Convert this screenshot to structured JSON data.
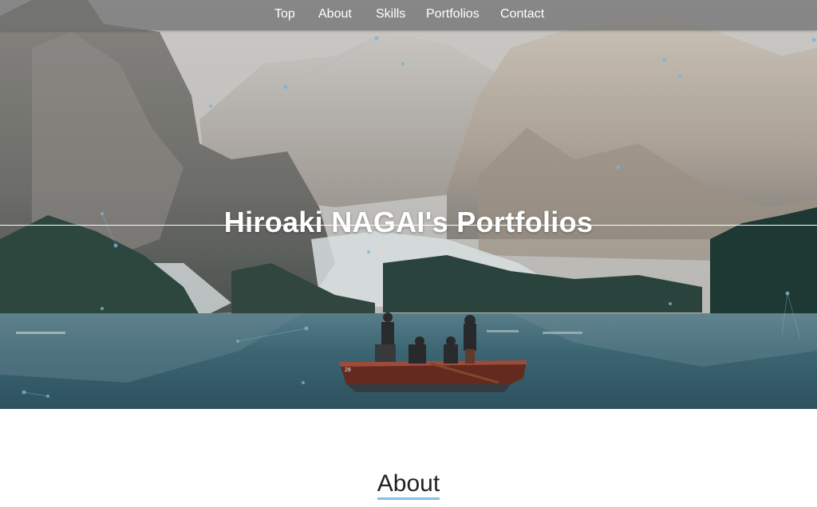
{
  "nav": {
    "items": [
      {
        "label": "Top"
      },
      {
        "label": "About"
      },
      {
        "label": "Skills"
      },
      {
        "label": "Portfolios"
      },
      {
        "label": "Contact"
      }
    ]
  },
  "hero": {
    "title": "Hiroaki NAGAI's Portfolios",
    "boat_number": "28"
  },
  "about": {
    "heading": "About"
  },
  "colors": {
    "nav_background": "#6e6e6e",
    "accent_underline": "#7fc4e8",
    "lake": "#3e6674",
    "boat": "#6b2a1e"
  }
}
